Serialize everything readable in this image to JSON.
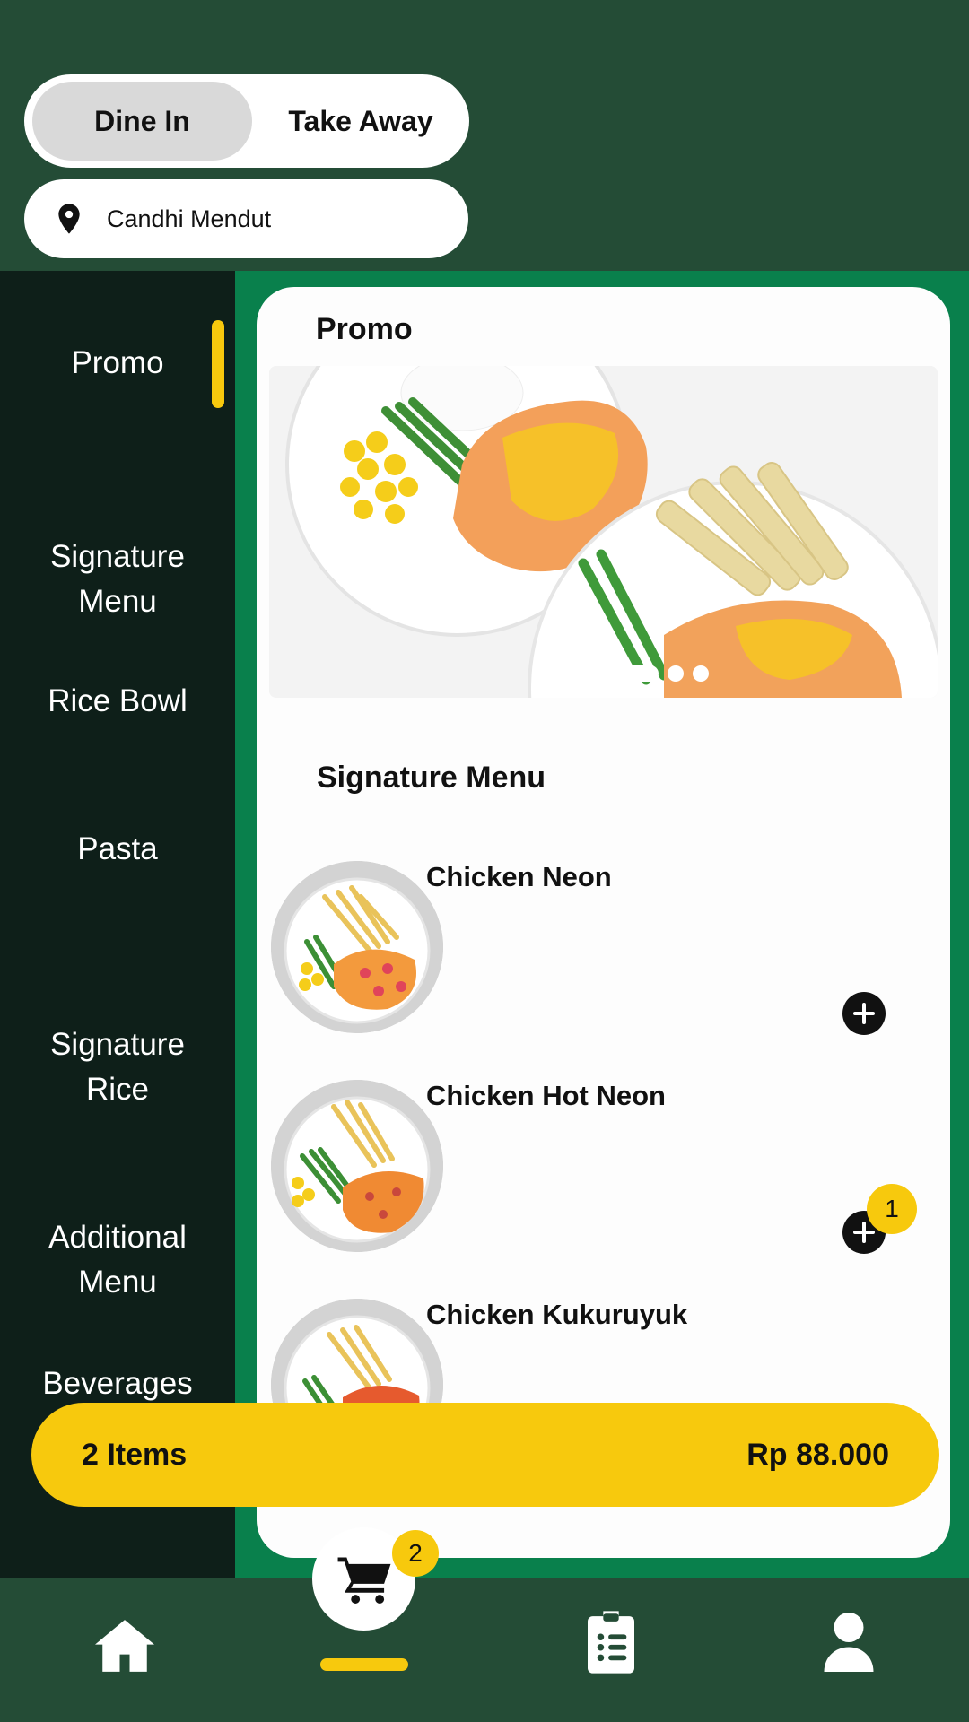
{
  "header": {
    "order_type": {
      "options": [
        "Dine In",
        "Take Away"
      ],
      "selected": "Dine In"
    },
    "location": "Candhi Mendut"
  },
  "sidebar": {
    "active": "Promo",
    "items": [
      {
        "label": "Promo"
      },
      {
        "label": "Signature\nMenu"
      },
      {
        "label": "Rice Bowl"
      },
      {
        "label": "Pasta"
      },
      {
        "label": "Signature\nRice"
      },
      {
        "label": "Additional\nMenu"
      },
      {
        "label": "Beverages"
      }
    ]
  },
  "content": {
    "promo_title": "Promo",
    "signature_title": "Signature Menu",
    "items": [
      {
        "name": "Chicken Neon",
        "qty": ""
      },
      {
        "name": "Chicken Hot Neon",
        "qty": "1"
      },
      {
        "name": "Chicken Kukuruyuk",
        "qty": ""
      }
    ]
  },
  "cart": {
    "items_label": "2 Items",
    "total": "Rp 88.000",
    "badge": "2"
  },
  "colors": {
    "header_bg": "#244c36",
    "sidebar_bg": "#0e1f19",
    "accent": "#f7c90d",
    "content_green": "#09804c"
  },
  "icons": {
    "location": "map-pin-icon",
    "add": "plus-circle-icon",
    "home": "home-icon",
    "cart": "shopping-cart-icon",
    "orders": "clipboard-list-icon",
    "profile": "user-icon"
  }
}
